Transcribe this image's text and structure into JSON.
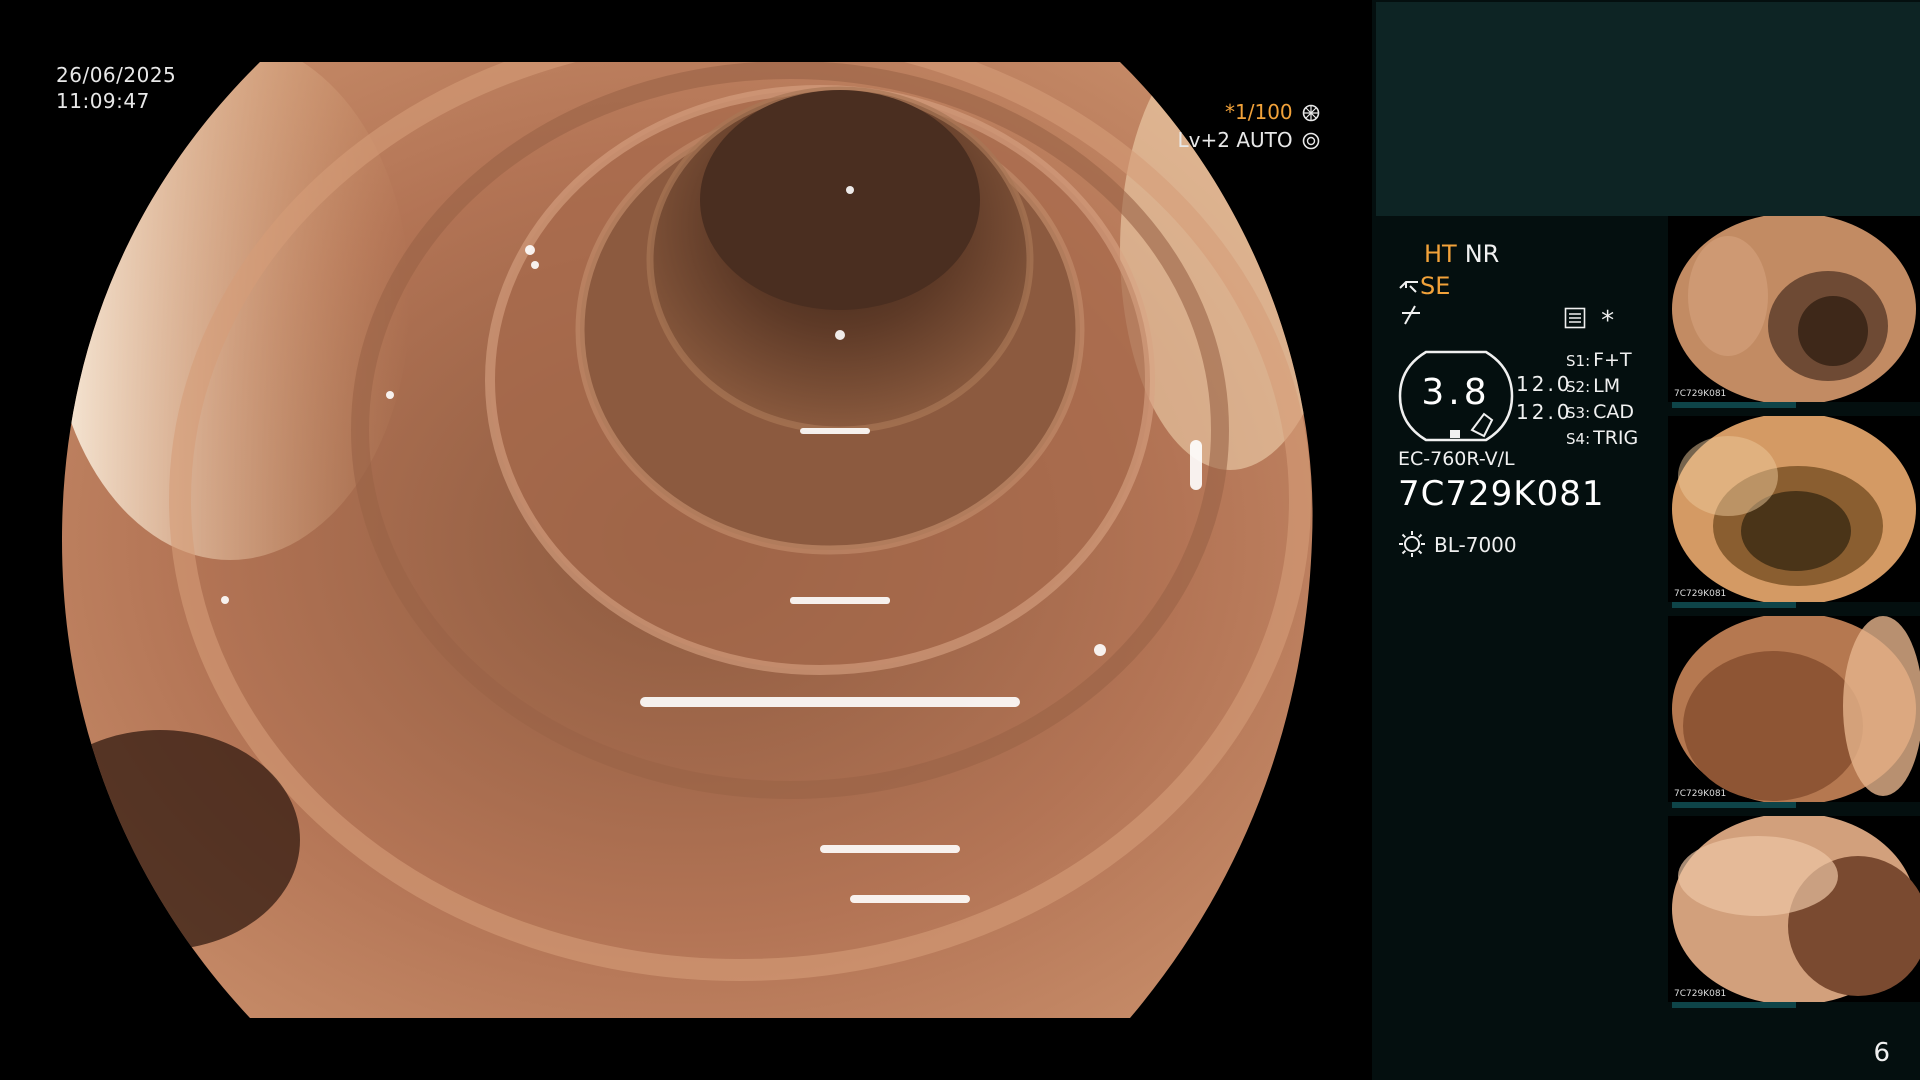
{
  "overlay": {
    "date": "26/06/2025",
    "time": "11:09:47",
    "shutter_speed": "*1/100",
    "shutter_icon": "aperture-icon",
    "level": "Lv+2",
    "exposure_mode": "AUTO",
    "exposure_icon": "iris-icon"
  },
  "panel": {
    "ht_label": "HT",
    "nr_label": "NR",
    "se_label": "SE",
    "se_icon": "pipe-icon",
    "freeze_icon": "slash-arrow-icon",
    "menu_icon": "list-icon",
    "star": "*",
    "hex_value": "3.8",
    "values": [
      "12.0",
      "12.0"
    ],
    "switches": [
      {
        "key": "S1:",
        "value": "F+T"
      },
      {
        "key": "S2:",
        "value": "LM"
      },
      {
        "key": "S3:",
        "value": "CAD"
      },
      {
        "key": "S4:",
        "value": "TRIG"
      }
    ],
    "scope_model": "EC-760R-V/L",
    "serial": "7C729K081",
    "light_source": "BL-7000",
    "light_icon": "sun-icon",
    "page_number": "6"
  },
  "colors": {
    "accent": "#f2a23a",
    "panel_bg": "#040f0f",
    "panel_top_bg": "#0d2424",
    "mucosa": "#b9795a"
  },
  "thumbnails": [
    {
      "label": "7C729K081"
    },
    {
      "label": "7C729K081"
    },
    {
      "label": "7C729K081"
    },
    {
      "label": "7C729K081"
    }
  ]
}
